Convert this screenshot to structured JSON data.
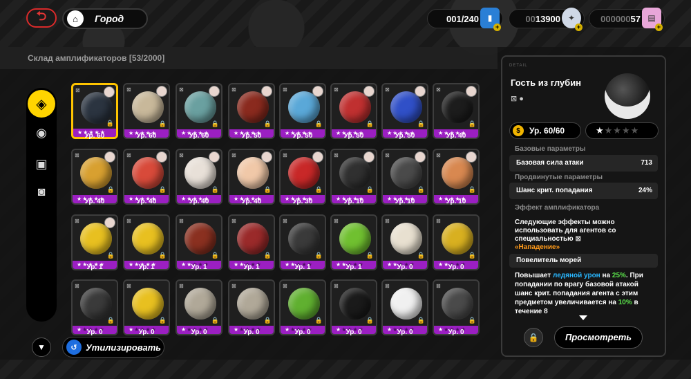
{
  "topbar": {
    "location": "Город",
    "resources": [
      {
        "value": "001/240",
        "dim": "",
        "icon": "battery-icon",
        "color": "#2a7fd6"
      },
      {
        "dim": "00",
        "value": "13900",
        "icon": "dennies-coin-icon",
        "color": "#cfd8e6"
      },
      {
        "dim": "000000",
        "value": "57",
        "icon": "film-ticket-icon",
        "color": "#e8a6d8"
      }
    ]
  },
  "storage": {
    "title": "Склад амплификаторов [53/2000]",
    "recycle_label": "Утилизировать",
    "cards": [
      {
        "level": "Ур. 60",
        "color": "#2b3440",
        "stars": 5,
        "selected": true
      },
      {
        "level": "Ур. 60",
        "color": "#c8b89a",
        "stars": 5
      },
      {
        "level": "Ур. 60",
        "color": "#6aa0a0",
        "stars": 5
      },
      {
        "level": "Ур. 50",
        "color": "#8a2a1e",
        "stars": 5
      },
      {
        "level": "Ур. 50",
        "color": "#5aa8d8",
        "stars": 5
      },
      {
        "level": "Ур. 50",
        "color": "#c03030",
        "stars": 5
      },
      {
        "level": "Ур. 50",
        "color": "#3050c8",
        "stars": 5
      },
      {
        "level": "Ур. 40",
        "color": "#1c1c1c",
        "stars": 5
      },
      {
        "level": "Ур. 40",
        "color": "#d8a030",
        "stars": 5
      },
      {
        "level": "Ур. 40",
        "color": "#d84a3a",
        "stars": 5
      },
      {
        "level": "Ур. 40",
        "color": "#e8e0d8",
        "stars": 5
      },
      {
        "level": "Ур. 40",
        "color": "#f0c8a8",
        "stars": 5
      },
      {
        "level": "Ур. 30",
        "color": "#c82828",
        "stars": 5
      },
      {
        "level": "Ур. 10",
        "color": "#303030",
        "stars": 5
      },
      {
        "level": "Ур. 10",
        "color": "#4a4a4a",
        "stars": 5
      },
      {
        "level": "Ур. 10",
        "color": "#d88850",
        "stars": 5
      },
      {
        "level": "Ур. 1",
        "color": "#e8c020",
        "stars": 5
      },
      {
        "level": "Ур. 1",
        "color": "#e8c020",
        "stars": 5
      },
      {
        "level": "Ур. 1",
        "color": "#8a3020",
        "stars": 2
      },
      {
        "level": "Ур. 1",
        "color": "#9a2a2a",
        "stars": 2
      },
      {
        "level": "Ур. 1",
        "color": "#3a3a3a",
        "stars": 2
      },
      {
        "level": "Ур. 1",
        "color": "#70c030",
        "stars": 2
      },
      {
        "level": "Ур. 0",
        "color": "#e8e0d0",
        "stars": 2
      },
      {
        "level": "Ур. 0",
        "color": "#d8b020",
        "stars": 2
      },
      {
        "level": "Ур. 0",
        "color": "#3a3a3a",
        "stars": 1
      },
      {
        "level": "Ур. 0",
        "color": "#e8c020",
        "stars": 1
      },
      {
        "level": "Ур. 0",
        "color": "#b0a898",
        "stars": 1
      },
      {
        "level": "Ур. 0",
        "color": "#b0a898",
        "stars": 1
      },
      {
        "level": "Ур. 0",
        "color": "#60b030",
        "stars": 1
      },
      {
        "level": "Ур. 0",
        "color": "#1a1a1a",
        "stars": 1
      },
      {
        "level": "Ур. 0",
        "color": "#f0f0f0",
        "stars": 1
      },
      {
        "level": "Ур. 0",
        "color": "#4a4a4a",
        "stars": 1
      }
    ]
  },
  "detail": {
    "tag": "DETAIL",
    "name": "Гость из глубин",
    "level": "Ур. 60/60",
    "stars": 1,
    "base_section": "Базовые параметры",
    "base_stat": "Базовая сила атаки",
    "base_value": "713",
    "adv_section": "Продвинутые параметры",
    "adv_stat": "Шанс крит. попадания",
    "adv_value": "24%",
    "effect_section": "Эффект амплификатора",
    "effect_text": "Следующие эффекты можно использовать для агентов со специальностью",
    "effect_spec": "«Нападение»",
    "effect_name": "Повелитель морей",
    "desc_1": "Повышает ",
    "desc_ice": "ледяной урон",
    "desc_2": " на ",
    "desc_pct1": "25%",
    "desc_3": ". При попадании по врагу базовой атакой шанс крит. попадания агента с этим предметом увеличивается на ",
    "desc_pct2": "10%",
    "desc_4": " в течение 8",
    "view_label": "Просмотреть"
  }
}
